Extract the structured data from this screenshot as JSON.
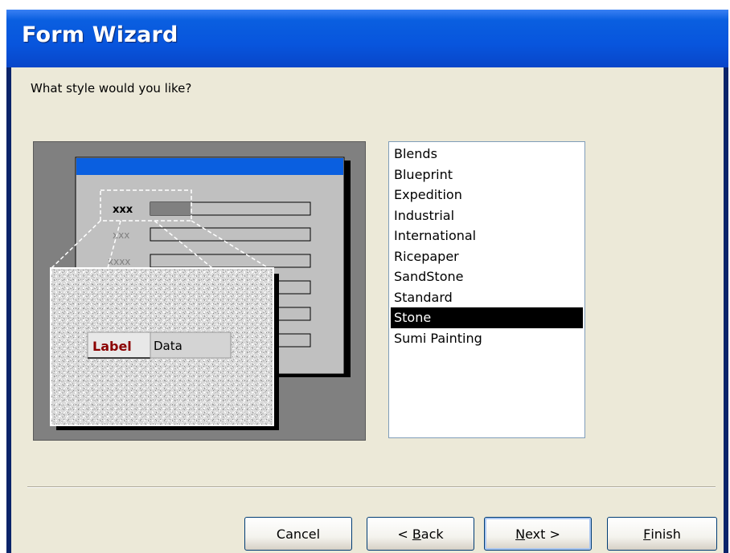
{
  "window": {
    "title": "Form Wizard"
  },
  "prompt": "What style would you like?",
  "preview": {
    "field_labels": [
      "xxx",
      "xxx",
      "xxxx"
    ],
    "zoom_label": "Label",
    "zoom_data": "Data"
  },
  "styles": {
    "items": [
      "Blends",
      "Blueprint",
      "Expedition",
      "Industrial",
      "International",
      "Ricepaper",
      "SandStone",
      "Standard",
      "Stone",
      "Sumi Painting"
    ],
    "selected": "Stone"
  },
  "buttons": {
    "cancel": "Cancel",
    "back_prefix": "< ",
    "back_mnemonic": "B",
    "back_rest": "ack",
    "next_mnemonic": "N",
    "next_rest": "ext >",
    "finish_mnemonic": "F",
    "finish_rest": "inish"
  },
  "colors": {
    "titlebar": "#0855dd",
    "selection": "#000000",
    "dialog_bg": "#ece9d8"
  }
}
